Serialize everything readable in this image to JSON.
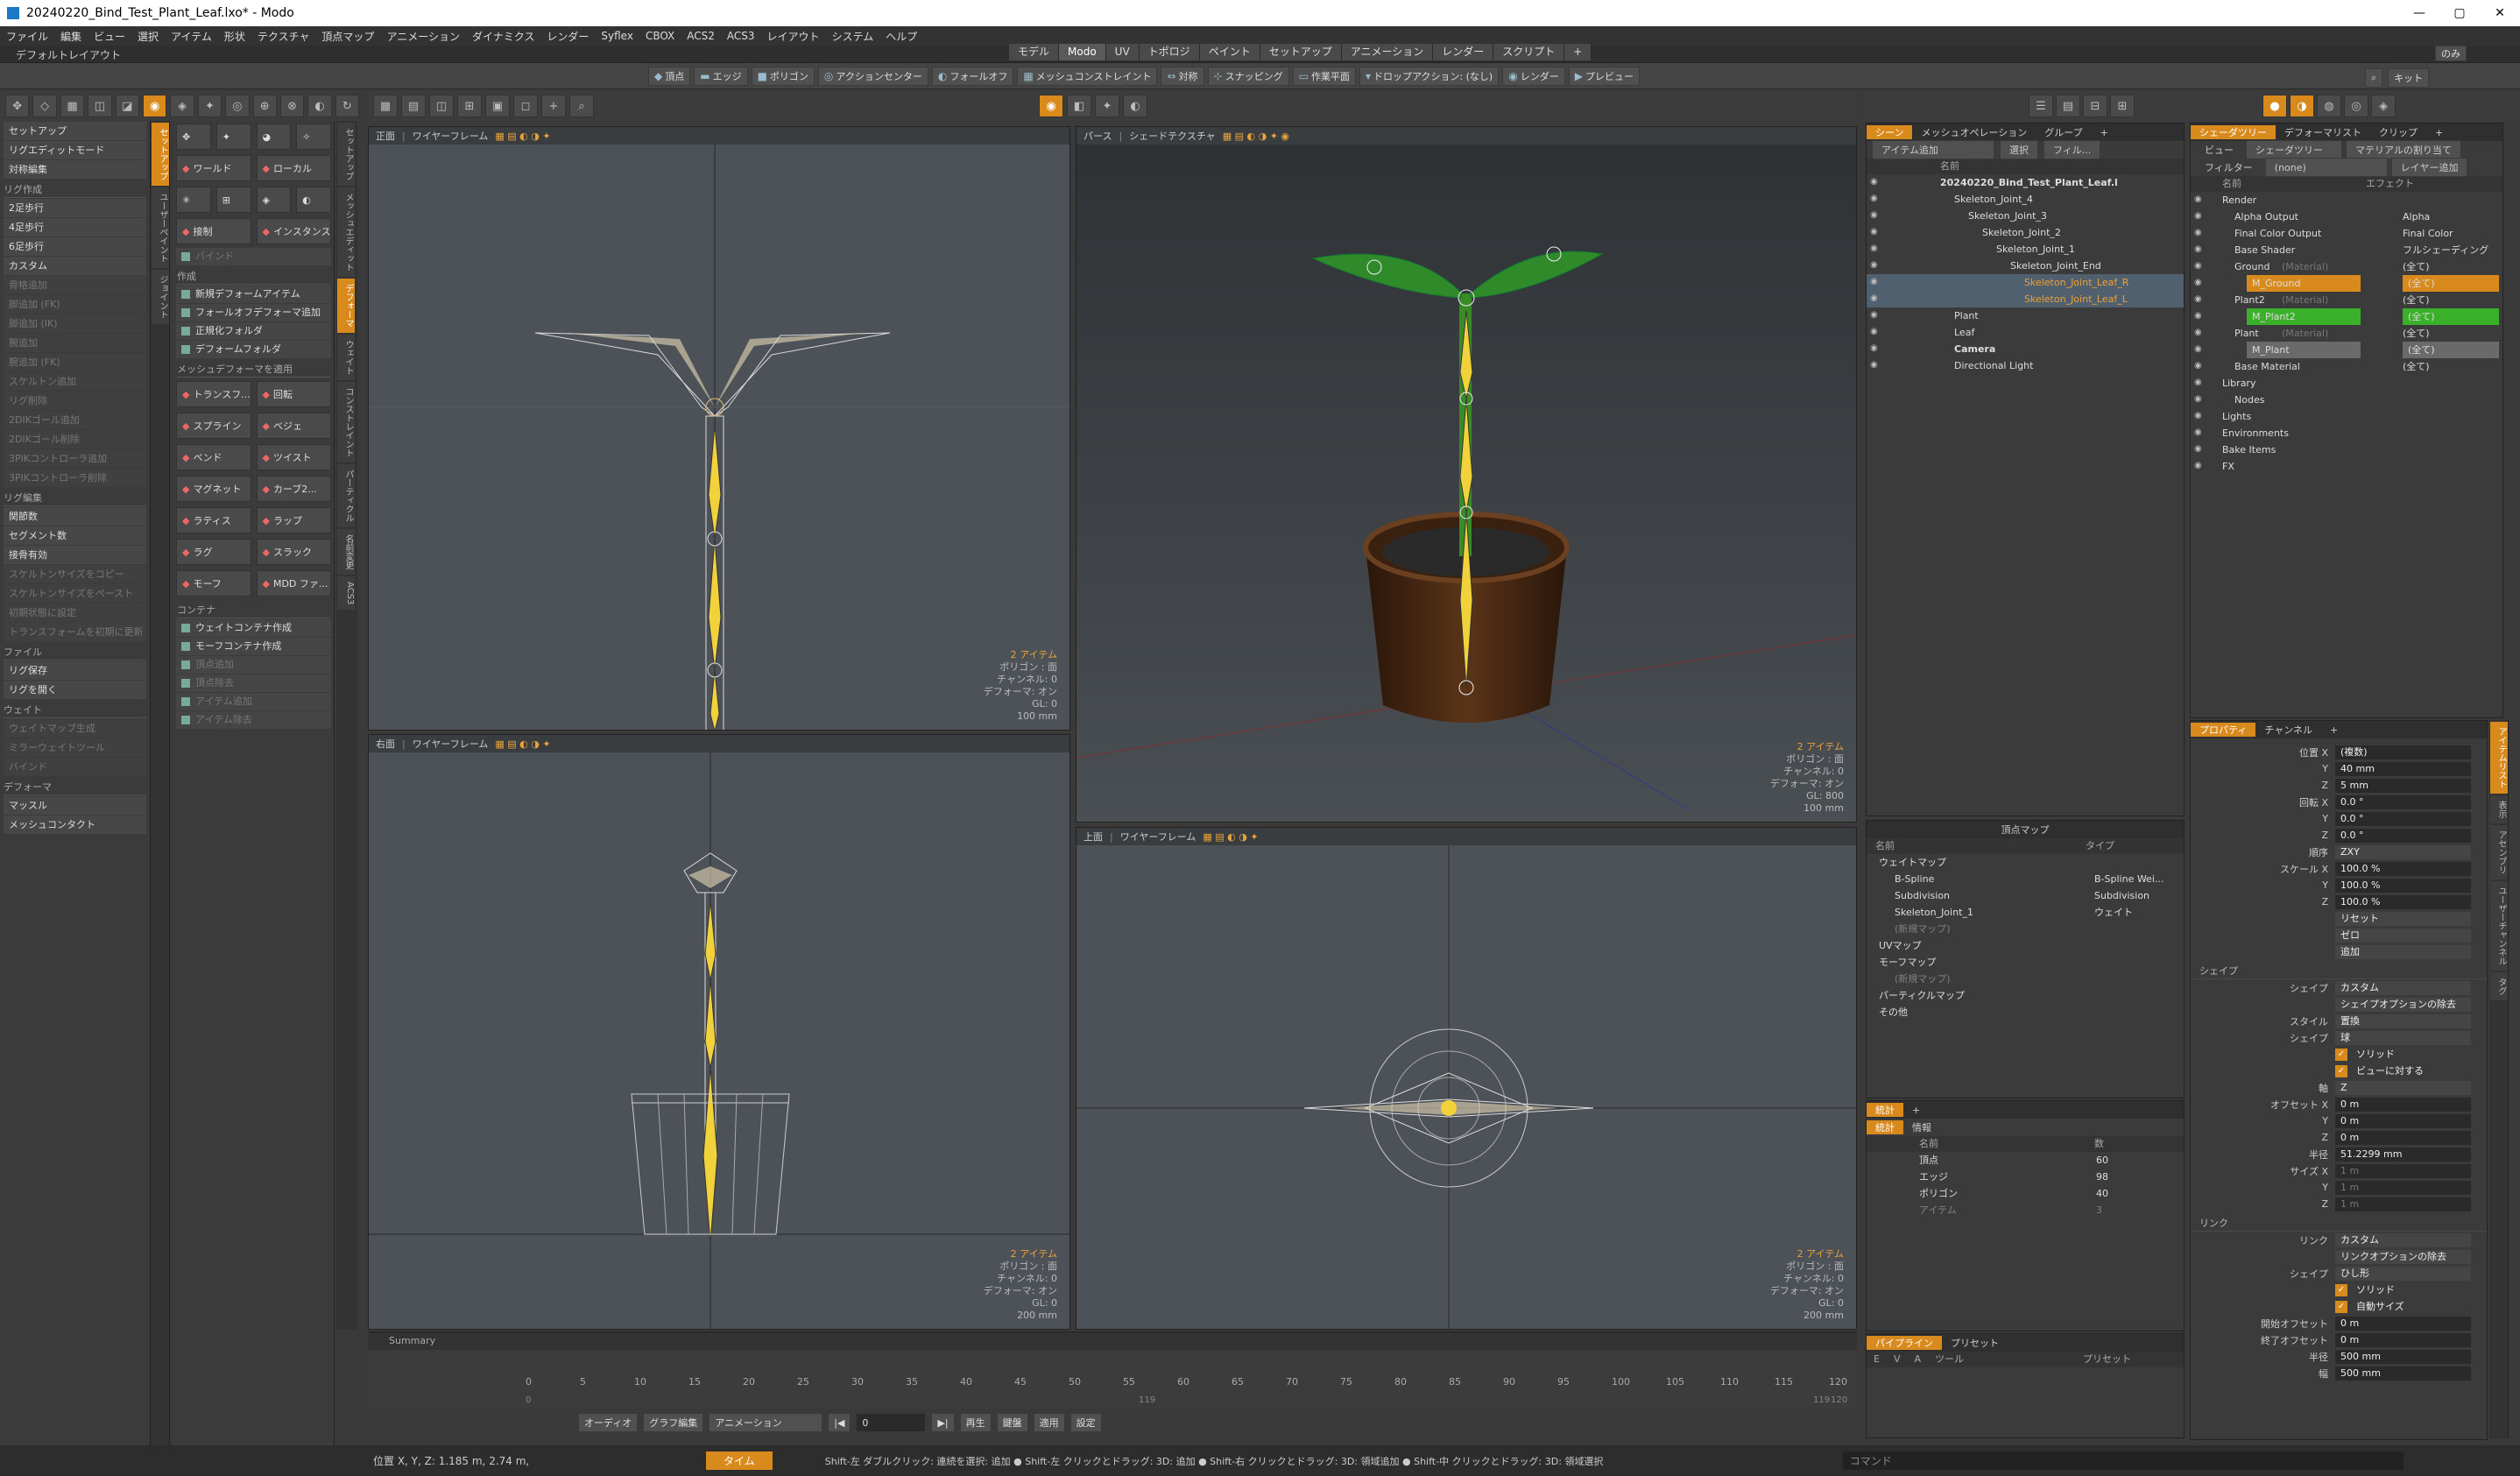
{
  "window": {
    "title": "20240220_Bind_Test_Plant_Leaf.lxo* - Modo",
    "minimize": "—",
    "maximize": "▢",
    "close": "✕"
  },
  "menu": [
    "ファイル",
    "編集",
    "ビュー",
    "選択",
    "アイテム",
    "形状",
    "テクスチャ",
    "頂点マップ",
    "アニメーション",
    "ダイナミクス",
    "レンダー",
    "Syflex",
    "CBOX",
    "ACS2",
    "ACS3",
    "レイアウト",
    "システム",
    "ヘルプ"
  ],
  "layout_tabs": [
    "モデル",
    "Modo",
    "UV",
    "トポロジ",
    "ペイント",
    "セットアップ",
    "アニメーション",
    "レンダー",
    "スクリプト",
    "+"
  ],
  "layout_name": "デフォルトレイアウト",
  "toolbar": [
    "頂点",
    "エッジ",
    "ポリゴン",
    "アクションセンター",
    "フォールオフ",
    "メッシュコンストレイント",
    "対称",
    "スナッピング",
    "作業平面",
    "ドロップアクション: (なし)",
    "レンダー",
    "プレビュー"
  ],
  "right_top": [
    "のみ",
    "キット"
  ],
  "left_items": {
    "setup": [
      "セットアップ",
      "リグエディットモード",
      "対称編集"
    ],
    "rig_head": "リグ作成",
    "rig": [
      "2足歩行",
      "4足歩行",
      "6足歩行",
      "カスタム"
    ],
    "rig_dim": [
      "骨格追加",
      "脚追加 (FK)",
      "脚追加 (IK)",
      "腕追加",
      "腕追加 (FK)",
      "スケルトン追加",
      "リグ削除",
      "2DIKゴール追加",
      "2DIKゴール削除",
      "3PIKコントローラ追加",
      "3PIKコントローラ削除"
    ],
    "edit_head": "リグ編集",
    "edit": [
      "関節数",
      "セグメント数",
      "接骨有効"
    ],
    "edit_dim": [
      "スケルトンサイズをコピー",
      "スケルトンサイズをペースト",
      "初期状態に設定",
      "トランスフォームを初期に更新"
    ],
    "file_head": "ファイル",
    "file": [
      "リグ保存",
      "リグを開く"
    ],
    "weight_head": "ウェイト",
    "weight": [
      "ウェイトマップ生成",
      "ミラーウェイトツール",
      "バインド"
    ],
    "deformer_head": "デフォーマ",
    "deformer": [
      "マッスル",
      "メッシュコンタクト"
    ]
  },
  "vtabs_left": [
    "セットアップ",
    "ユーザーペイント",
    "ジョイント"
  ],
  "tool_panel": {
    "row1": [
      "ワールド",
      "ローカル"
    ],
    "row2": [
      "接制",
      "インスタンス"
    ],
    "bind": "バインド",
    "create_head": "作成",
    "create": [
      "新規デフォームアイテム",
      "フォールオフデフォーマ追加"
    ],
    "folders": [
      "正規化フォルダ",
      "デフォームフォルダ"
    ],
    "apply_head": "メッシュデフォーマを適用",
    "apply": [
      [
        "トランスフ...",
        "回転"
      ],
      [
        "スプライン",
        "ベジェ"
      ],
      [
        "ベンド",
        "ツイスト"
      ],
      [
        "マグネット",
        "カーブ2..."
      ],
      [
        "ラティス",
        "ラップ"
      ],
      [
        "ラグ",
        "スラック"
      ],
      [
        "モーフ",
        "MDD ファ..."
      ]
    ],
    "container_head": "コンテナ",
    "container": [
      "ウェイトコンテナ作成",
      "モーフコンテナ作成"
    ],
    "container_dim": [
      "頂点追加",
      "頂点除去",
      "アイテム追加",
      "アイテム除去"
    ]
  },
  "vtabs_right": [
    "セットアップ",
    "メッシュエディット",
    "デフォーマ",
    "ウェイト",
    "コンストレイント",
    "パーティクル",
    "名前変更",
    "ACS3"
  ],
  "viewports": {
    "front": {
      "view": "正面",
      "shade": "ワイヤーフレーム",
      "info": [
        "2 アイテム",
        "ポリゴン : 面",
        "チャンネル: 0",
        "デフォーマ: オン",
        "GL: 0",
        "100 mm"
      ]
    },
    "persp": {
      "view": "パース",
      "shade": "シェードテクスチャ",
      "info": [
        "2 アイテム",
        "ポリゴン : 面",
        "チャンネル: 0",
        "デフォーマ: オン",
        "GL: 800",
        "100 mm"
      ]
    },
    "right": {
      "view": "右面",
      "shade": "ワイヤーフレーム",
      "info": [
        "2 アイテム",
        "ポリゴン : 面",
        "チャンネル: 0",
        "デフォーマ: オン",
        "GL: 0",
        "200 mm"
      ]
    },
    "top": {
      "view": "上面",
      "shade": "ワイヤーフレーム",
      "info": [
        "2 アイテム",
        "ポリゴン : 面",
        "チャンネル: 0",
        "デフォーマ: オン",
        "GL: 0",
        "200 mm"
      ]
    }
  },
  "scene_tabs": [
    "シーン",
    "メッシュオペレーション",
    "グループ",
    "+"
  ],
  "scene_tools": [
    "アイテム追加",
    "選択",
    "フィル..."
  ],
  "scene_header": "名前",
  "scene_items": [
    {
      "name": "20240220_Bind_Test_Plant_Leaf.l",
      "indent": 0,
      "style": "bold"
    },
    {
      "name": "Skeleton_Joint_4",
      "indent": 1
    },
    {
      "name": "Skeleton_Joint_3",
      "indent": 2
    },
    {
      "name": "Skeleton_Joint_2",
      "indent": 3
    },
    {
      "name": "Skeleton_Joint_1",
      "indent": 4
    },
    {
      "name": "Skeleton_Joint_End",
      "indent": 5
    },
    {
      "name": "Skeleton_Joint_Leaf_R",
      "indent": 6,
      "style": "orange"
    },
    {
      "name": "Skeleton_Joint_Leaf_L",
      "indent": 6,
      "style": "orange"
    },
    {
      "name": "Plant",
      "indent": 1
    },
    {
      "name": "Leaf",
      "indent": 1
    },
    {
      "name": "Camera",
      "indent": 1,
      "style": "bold"
    },
    {
      "name": "Directional Light",
      "indent": 1
    }
  ],
  "vmap": {
    "title": "頂点マップ",
    "cols": [
      "名前",
      "タイプ"
    ],
    "rows": [
      {
        "name": "ウェイトマップ",
        "type": "",
        "indent": 0
      },
      {
        "name": "B-Spline",
        "type": "B-Spline Wei...",
        "indent": 1
      },
      {
        "name": "Subdivision",
        "type": "Subdivision",
        "indent": 1
      },
      {
        "name": "Skeleton_Joint_1",
        "type": "ウェイト",
        "indent": 1
      },
      {
        "name": "(新規マップ)",
        "type": "",
        "indent": 1,
        "dim": true
      },
      {
        "name": "UVマップ",
        "type": "",
        "indent": 0
      },
      {
        "name": "モーフマップ",
        "type": "",
        "indent": 0
      },
      {
        "name": "(新規マップ)",
        "type": "",
        "indent": 1,
        "dim": true
      },
      {
        "name": "パーティクルマップ",
        "type": "",
        "indent": 0
      },
      {
        "name": "その他",
        "type": "",
        "indent": 0
      }
    ]
  },
  "stats": {
    "tabs": [
      "統計",
      "+"
    ],
    "sub_tabs": [
      "統計",
      "情報"
    ],
    "cols": [
      "名前",
      "数"
    ],
    "rows": [
      {
        "name": "頂点",
        "count": "60"
      },
      {
        "name": "エッジ",
        "count": "98"
      },
      {
        "name": "ポリゴン",
        "count": "40"
      },
      {
        "name": "アイテム",
        "count": "3",
        "dim": true
      }
    ]
  },
  "pipeline": {
    "tabs": [
      "パイプライン",
      "プリセット"
    ],
    "cols": [
      "E",
      "V",
      "A",
      "ツール",
      "プリセット"
    ]
  },
  "shader_tabs": [
    "シェーダツリー",
    "デフォーマリスト",
    "クリップ",
    "+"
  ],
  "shader_tools": {
    "view": "ビュー",
    "view_val": "シェーダツリー",
    "assign": "マテリアルの割り当て",
    "filter": "フィルター",
    "filter_val": "(none)",
    "add_layer": "レイヤー追加"
  },
  "shader_cols": [
    "名前",
    "エフェクト"
  ],
  "shader_items": [
    {
      "name": "Render",
      "effect": "",
      "indent": 0
    },
    {
      "name": "Alpha Output",
      "effect": "Alpha",
      "indent": 1
    },
    {
      "name": "Final Color Output",
      "effect": "Final Color",
      "indent": 1
    },
    {
      "name": "Base Shader",
      "effect": "フルシェーディング",
      "indent": 1
    },
    {
      "name": "Ground",
      "tag": "(Material)",
      "effect": "(全て)",
      "indent": 1
    },
    {
      "name": "M_Ground",
      "effect": "(全て)",
      "indent": 2,
      "style": "orange-bg"
    },
    {
      "name": "Plant2",
      "tag": "(Material)",
      "effect": "(全て)",
      "indent": 1
    },
    {
      "name": "M_Plant2",
      "effect": "(全て)",
      "indent": 2,
      "style": "green-bg"
    },
    {
      "name": "Plant",
      "tag": "(Material)",
      "effect": "(全て)",
      "indent": 1
    },
    {
      "name": "M_Plant",
      "effect": "(全て)",
      "indent": 2,
      "style": "gray-bg"
    },
    {
      "name": "Base Material",
      "effect": "(全て)",
      "indent": 1
    },
    {
      "name": "Library",
      "effect": "",
      "indent": 0
    },
    {
      "name": "Nodes",
      "effect": "",
      "indent": 1
    },
    {
      "name": "Lights",
      "effect": "",
      "indent": 0
    },
    {
      "name": "Environments",
      "effect": "",
      "indent": 0
    },
    {
      "name": "Bake Items",
      "effect": "",
      "indent": 0
    },
    {
      "name": "FX",
      "effect": "",
      "indent": 0
    }
  ],
  "props_tabs": [
    "プロパティ",
    "チャンネル",
    "+"
  ],
  "props": [
    {
      "label": "位置 X",
      "val": "(複数)"
    },
    {
      "label": "Y",
      "val": "40 mm"
    },
    {
      "label": "Z",
      "val": "5 mm"
    },
    {
      "label": "回転 X",
      "val": "0.0 °"
    },
    {
      "label": "Y",
      "val": "0.0 °"
    },
    {
      "label": "Z",
      "val": "0.0 °"
    },
    {
      "label": "順序",
      "val": "ZXY",
      "dd": true
    },
    {
      "label": "スケール X",
      "val": "100.0 %"
    },
    {
      "label": "Y",
      "val": "100.0 %"
    },
    {
      "label": "Z",
      "val": "100.0 %"
    },
    {
      "label": "",
      "val": "リセット",
      "dd": true
    },
    {
      "label": "",
      "val": "ゼロ",
      "dd": true
    },
    {
      "label": "",
      "val": "追加",
      "dd": true
    }
  ],
  "shape_sec": "シェイプ",
  "shape_props": [
    {
      "label": "シェイプ",
      "val": "カスタム",
      "dd": true
    },
    {
      "label": "",
      "val": "シェイプオプションの除去",
      "dd": true
    },
    {
      "label": "スタイル",
      "val": "置換",
      "dd": true
    },
    {
      "label": "シェイプ",
      "val": "球",
      "dd": true
    },
    {
      "label": "",
      "val": "ソリッド",
      "check": true
    },
    {
      "label": "",
      "val": "ビューに対する",
      "check": true
    },
    {
      "label": "軸",
      "val": "Z",
      "dd": true
    },
    {
      "label": "オフセット X",
      "val": "0 m"
    },
    {
      "label": "Y",
      "val": "0 m"
    },
    {
      "label": "Z",
      "val": "0 m"
    },
    {
      "label": "半径",
      "val": "51.2299 mm"
    },
    {
      "label": "サイズ X",
      "val": "1 m",
      "dim": true
    },
    {
      "label": "Y",
      "val": "1 m",
      "dim": true
    },
    {
      "label": "Z",
      "val": "1 m",
      "dim": true
    }
  ],
  "link_sec": "リンク",
  "link_props": [
    {
      "label": "リンク",
      "val": "カスタム",
      "dd": true
    },
    {
      "label": "",
      "val": "リンクオプションの除去",
      "dd": true
    },
    {
      "label": "シェイプ",
      "val": "ひし形",
      "dd": true
    },
    {
      "label": "",
      "val": "ソリッド",
      "check": true
    },
    {
      "label": "",
      "val": "自動サイズ",
      "check": true
    },
    {
      "label": "開始オフセット",
      "val": "0 m"
    },
    {
      "label": "終了オフセット",
      "val": "0 m"
    },
    {
      "label": "半径",
      "val": "500 mm"
    },
    {
      "label": "幅",
      "val": "500 mm"
    }
  ],
  "right_vtabs": [
    "アイテムリスト",
    "表示",
    "アセンブリ",
    "ユーザーチャンネル",
    "タグ"
  ],
  "timeline": {
    "summary": "Summary",
    "ticks": [
      "0",
      "5",
      "10",
      "15",
      "20",
      "25",
      "30",
      "35",
      "40",
      "45",
      "50",
      "55",
      "60",
      "65",
      "70",
      "75",
      "80",
      "85",
      "90",
      "95",
      "100",
      "105",
      "110",
      "115",
      "120"
    ],
    "start": "0",
    "end": "120",
    "mid_a": "119",
    "mid_b": "119"
  },
  "transport": {
    "audio": "オーディオ",
    "graph": "グラフ編集",
    "anim": "アニメーション",
    "frame": "0",
    "play": "再生",
    "keys": "鍵盤",
    "apply": "適用",
    "settings": "設定"
  },
  "status": {
    "coords": "位置 X, Y, Z:   1.185 m, 2.74 m,",
    "mode": "タイム",
    "hint": "Shift-左 ダブルクリック: 連続を選択: 追加 ● Shift-左 クリックとドラッグ: 3D: 追加 ● Shift-右 クリックとドラッグ: 3D: 領域追加 ● Shift-中 クリックとドラッグ: 3D: 領域選択",
    "command": "コマンド"
  },
  "colors": {
    "accent": "#d88a1c",
    "bone": "#f2d23a",
    "leaf": "#2e8a28",
    "pot": "#4b2a14",
    "selection_green": "#3bb02a"
  }
}
